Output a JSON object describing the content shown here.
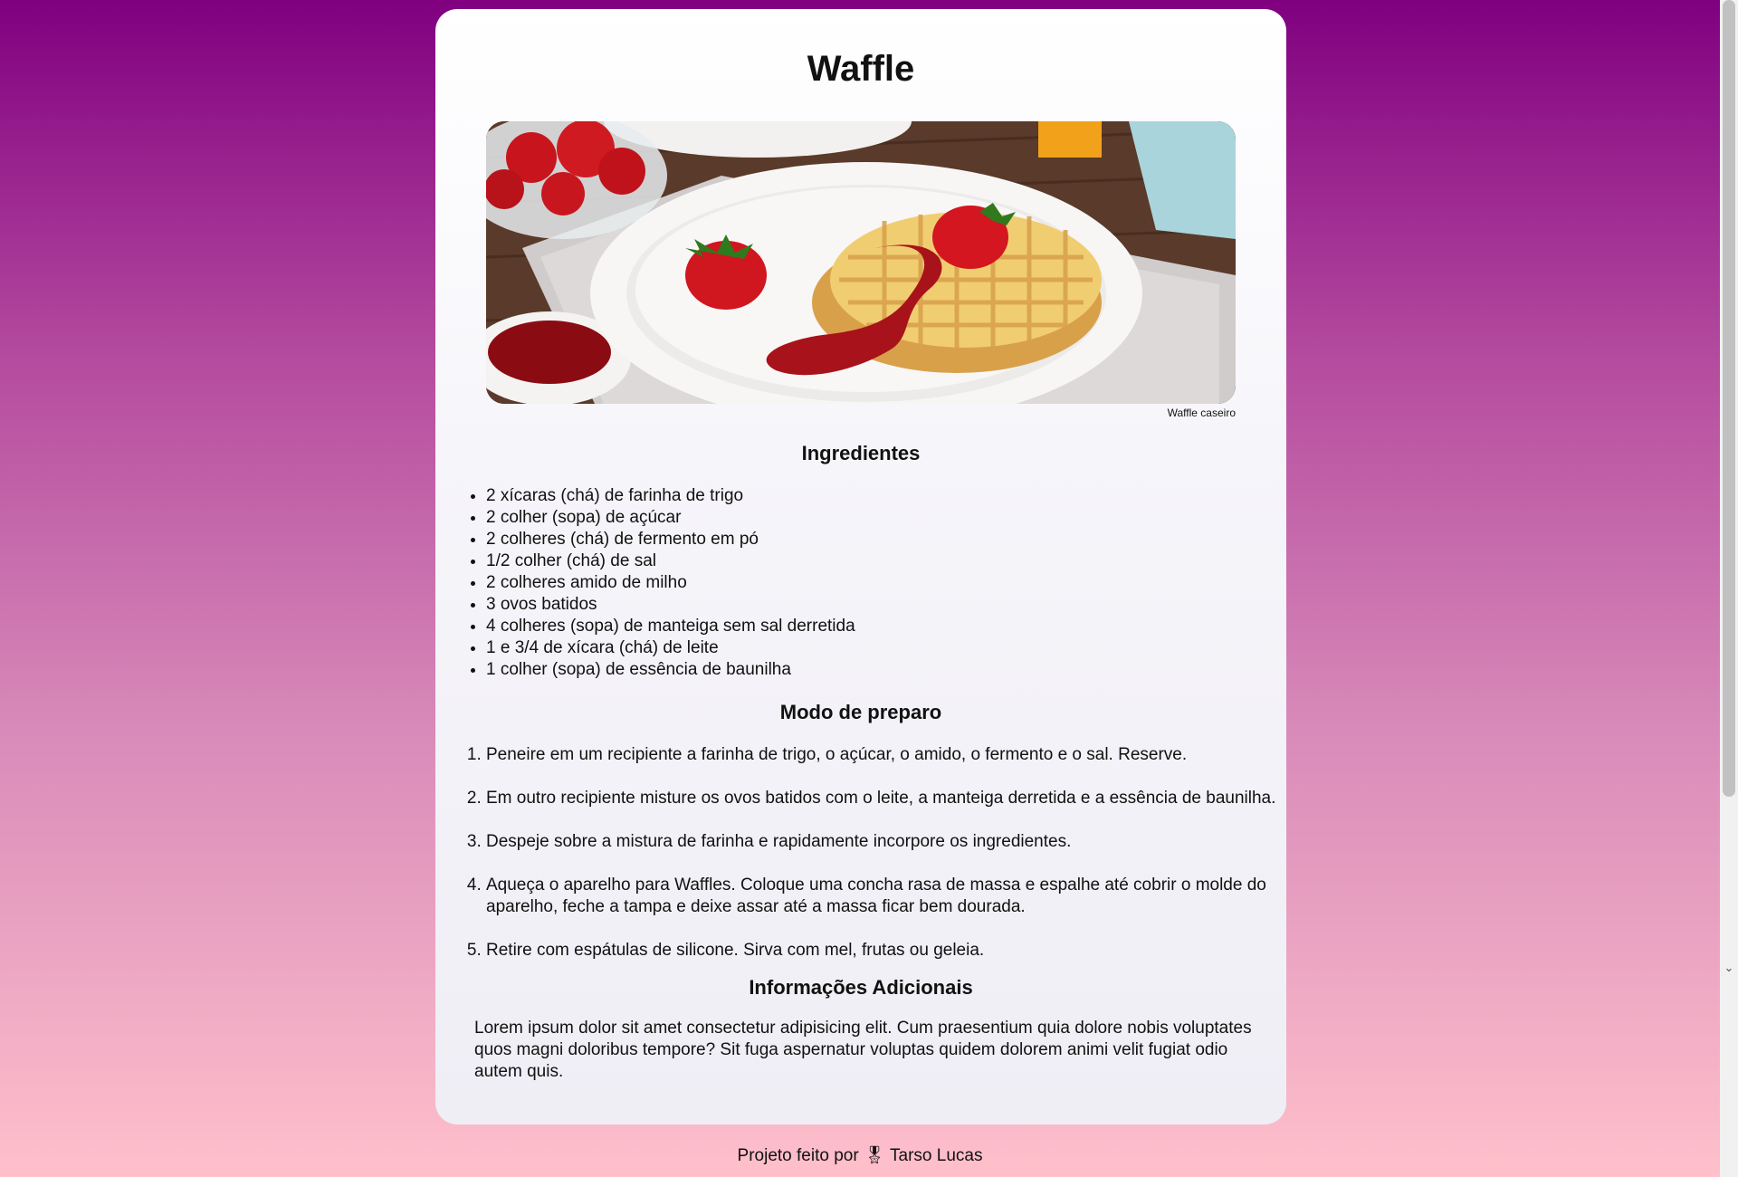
{
  "recipe": {
    "title": "Waffle",
    "image_caption": "Waffle caseiro",
    "ingredients_heading": "Ingredientes",
    "ingredients": [
      "2 xícaras (chá) de farinha de trigo",
      "2 colher (sopa) de açúcar",
      "2 colheres (chá) de fermento em pó",
      "1/2 colher (chá) de sal",
      "2 colheres amido de milho",
      "3 ovos batidos",
      "4 colheres (sopa) de manteiga sem sal derretida",
      "1 e 3/4 de xícara (chá) de leite",
      "1 colher (sopa) de essência de baunilha"
    ],
    "preparation_heading": "Modo de preparo",
    "steps": [
      "Peneire em um recipiente a farinha de trigo, o açúcar, o amido, o fermento e o sal. Reserve.",
      "Em outro recipiente misture os ovos batidos com o leite, a manteiga derretida e a essência de baunilha.",
      "Despeje sobre a mistura de farinha e rapidamente incorpore os ingredientes.",
      "Aqueça o aparelho para Waffles. Coloque uma concha rasa de massa e espalhe até cobrir o molde do aparelho, feche a tampa e deixe assar até a massa ficar bem dourada.",
      "Retire com espátulas de silicone. Sirva com mel, frutas ou geleia."
    ],
    "info_heading": "Informações Adicionais",
    "info_text": "Lorem ipsum dolor sit amet consectetur adipisicing elit. Cum praesentium quia dolore nobis voluptates quos magni doloribus tempore? Sit fuga aspernatur voluptas quidem dolorem animi velit fugiat odio autem quis."
  },
  "footer": {
    "prefix": "Projeto feito por",
    "icon": "🎖",
    "author": "Tarso Lucas"
  },
  "icons": {
    "scroll_down": "chevron-down-icon"
  }
}
